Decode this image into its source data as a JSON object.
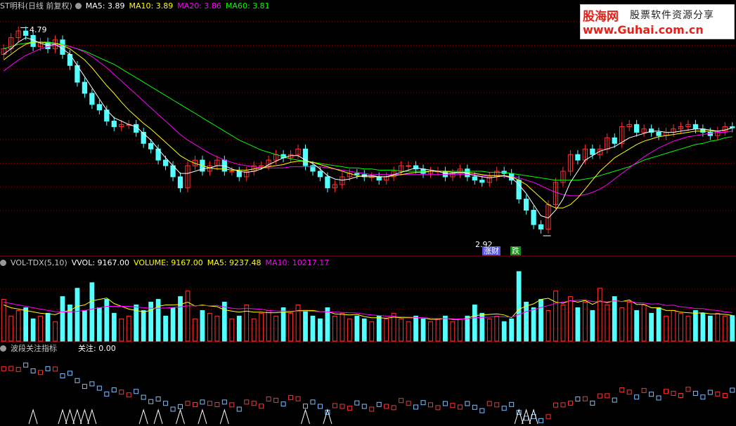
{
  "price_header": {
    "title": "ST明科(日线 前复权)",
    "ma5": "MA5: 3.89",
    "ma10": "MA10: 3.89",
    "ma20": "MA20: 3.86",
    "ma60": "MA60: 3.81"
  },
  "volume_header": {
    "title": "VOL-TDX(5,10)",
    "vvol": "VVOL: 9167.00",
    "volume": "VOLUME: 9167.00",
    "ma5": "MA5: 9237.48",
    "ma10": "MA10: 10217.17"
  },
  "indicator_header": {
    "title": "波段关注指标",
    "value": "关注: 0.00"
  },
  "logo": {
    "name": "股海网",
    "slogan": "股票软件资源分享",
    "url": "www.Guhai.com.cn"
  },
  "annotations": {
    "high_label": "4.79",
    "low_label": "2.92",
    "tag1": "涨财",
    "tag2": "跌"
  },
  "colors": {
    "up": "#ff3232",
    "down": "#54ffff",
    "ma5": "#ffffff",
    "ma10": "#ffff00",
    "ma20": "#ff00ff",
    "ma60": "#00ff00",
    "grid": "#8b0000"
  },
  "chart_data": {
    "type": "candlestick",
    "title": "ST明科(日线 前复权)",
    "ylim": [
      2.8,
      4.95
    ],
    "price_high": 4.79,
    "price_low": 2.92,
    "close": [
      4.6,
      4.7,
      4.76,
      4.72,
      4.62,
      4.66,
      4.6,
      4.68,
      4.55,
      4.45,
      4.3,
      4.2,
      4.1,
      4.05,
      3.95,
      3.9,
      3.92,
      3.92,
      3.85,
      3.75,
      3.7,
      3.6,
      3.55,
      3.45,
      3.35,
      3.55,
      3.6,
      3.5,
      3.55,
      3.6,
      3.5,
      3.5,
      3.45,
      3.5,
      3.55,
      3.55,
      3.6,
      3.65,
      3.62,
      3.65,
      3.7,
      3.55,
      3.5,
      3.45,
      3.35,
      3.38,
      3.45,
      3.48,
      3.47,
      3.45,
      3.45,
      3.42,
      3.45,
      3.5,
      3.55,
      3.55,
      3.52,
      3.48,
      3.5,
      3.5,
      3.45,
      3.48,
      3.52,
      3.45,
      3.42,
      3.4,
      3.45,
      3.5,
      3.48,
      3.42,
      3.25,
      3.15,
      3.02,
      2.98,
      3.2,
      3.4,
      3.5,
      3.65,
      3.6,
      3.7,
      3.65,
      3.7,
      3.8,
      3.75,
      3.9,
      3.92,
      3.85,
      3.88,
      3.85,
      3.82,
      3.85,
      3.88,
      3.9,
      3.92,
      3.88,
      3.85,
      3.82,
      3.86,
      3.9,
      3.89
    ],
    "ma5": [
      4.55,
      4.6,
      4.66,
      4.7,
      4.68,
      4.65,
      4.63,
      4.64,
      4.6,
      4.55,
      4.45,
      4.35,
      4.25,
      4.15,
      4.05,
      3.98,
      3.95,
      3.92,
      3.9,
      3.84,
      3.78,
      3.7,
      3.62,
      3.55,
      3.48,
      3.48,
      3.5,
      3.52,
      3.53,
      3.55,
      3.55,
      3.52,
      3.5,
      3.49,
      3.5,
      3.52,
      3.56,
      3.59,
      3.62,
      3.64,
      3.64,
      3.6,
      3.57,
      3.52,
      3.46,
      3.43,
      3.42,
      3.43,
      3.45,
      3.46,
      3.46,
      3.45,
      3.45,
      3.47,
      3.49,
      3.51,
      3.53,
      3.52,
      3.51,
      3.5,
      3.48,
      3.48,
      3.49,
      3.48,
      3.46,
      3.45,
      3.44,
      3.45,
      3.46,
      3.44,
      3.38,
      3.3,
      3.2,
      3.1,
      3.08,
      3.15,
      3.25,
      3.4,
      3.5,
      3.6,
      3.64,
      3.68,
      3.7,
      3.72,
      3.76,
      3.8,
      3.82,
      3.84,
      3.86,
      3.86,
      3.85,
      3.85,
      3.86,
      3.87,
      3.88,
      3.88,
      3.87,
      3.86,
      3.87,
      3.89
    ],
    "ma10": [
      4.5,
      4.55,
      4.6,
      4.64,
      4.66,
      4.66,
      4.65,
      4.65,
      4.63,
      4.6,
      4.55,
      4.5,
      4.43,
      4.35,
      4.27,
      4.2,
      4.12,
      4.05,
      3.99,
      3.93,
      3.88,
      3.82,
      3.76,
      3.7,
      3.64,
      3.6,
      3.57,
      3.55,
      3.53,
      3.52,
      3.52,
      3.51,
      3.51,
      3.51,
      3.52,
      3.53,
      3.54,
      3.55,
      3.56,
      3.58,
      3.59,
      3.59,
      3.58,
      3.56,
      3.54,
      3.52,
      3.5,
      3.48,
      3.46,
      3.45,
      3.45,
      3.45,
      3.45,
      3.46,
      3.47,
      3.48,
      3.49,
      3.49,
      3.5,
      3.5,
      3.5,
      3.49,
      3.49,
      3.49,
      3.48,
      3.47,
      3.46,
      3.46,
      3.46,
      3.45,
      3.42,
      3.38,
      3.32,
      3.26,
      3.2,
      3.17,
      3.17,
      3.2,
      3.26,
      3.34,
      3.42,
      3.5,
      3.56,
      3.62,
      3.66,
      3.7,
      3.74,
      3.77,
      3.79,
      3.81,
      3.82,
      3.83,
      3.84,
      3.85,
      3.86,
      3.86,
      3.86,
      3.86,
      3.87,
      3.89
    ],
    "ma20": [
      4.4,
      4.45,
      4.5,
      4.54,
      4.57,
      4.6,
      4.62,
      4.63,
      4.63,
      4.62,
      4.6,
      4.57,
      4.53,
      4.48,
      4.43,
      4.37,
      4.31,
      4.25,
      4.19,
      4.13,
      4.07,
      4.01,
      3.95,
      3.89,
      3.83,
      3.78,
      3.74,
      3.7,
      3.66,
      3.63,
      3.6,
      3.58,
      3.56,
      3.55,
      3.54,
      3.53,
      3.53,
      3.53,
      3.53,
      3.54,
      3.54,
      3.54,
      3.54,
      3.54,
      3.53,
      3.52,
      3.51,
      3.5,
      3.49,
      3.48,
      3.47,
      3.47,
      3.47,
      3.47,
      3.47,
      3.47,
      3.47,
      3.47,
      3.47,
      3.47,
      3.47,
      3.47,
      3.47,
      3.47,
      3.47,
      3.46,
      3.46,
      3.46,
      3.45,
      3.45,
      3.44,
      3.42,
      3.4,
      3.37,
      3.34,
      3.31,
      3.29,
      3.28,
      3.28,
      3.29,
      3.31,
      3.34,
      3.38,
      3.43,
      3.48,
      3.53,
      3.58,
      3.63,
      3.67,
      3.71,
      3.74,
      3.77,
      3.79,
      3.81,
      3.82,
      3.83,
      3.84,
      3.85,
      3.85,
      3.86
    ],
    "ma60": [
      4.6,
      4.62,
      4.64,
      4.65,
      4.66,
      4.66,
      4.66,
      4.65,
      4.64,
      4.62,
      4.6,
      4.58,
      4.55,
      4.52,
      4.49,
      4.46,
      4.42,
      4.38,
      4.34,
      4.3,
      4.26,
      4.22,
      4.18,
      4.14,
      4.1,
      4.06,
      4.02,
      3.98,
      3.94,
      3.9,
      3.86,
      3.82,
      3.78,
      3.75,
      3.72,
      3.69,
      3.67,
      3.65,
      3.63,
      3.61,
      3.6,
      3.59,
      3.58,
      3.57,
      3.56,
      3.55,
      3.54,
      3.53,
      3.53,
      3.52,
      3.52,
      3.51,
      3.51,
      3.51,
      3.5,
      3.5,
      3.5,
      3.5,
      3.5,
      3.5,
      3.5,
      3.5,
      3.5,
      3.5,
      3.5,
      3.5,
      3.49,
      3.49,
      3.49,
      3.48,
      3.47,
      3.46,
      3.45,
      3.44,
      3.43,
      3.42,
      3.42,
      3.42,
      3.42,
      3.43,
      3.44,
      3.46,
      3.48,
      3.5,
      3.52,
      3.54,
      3.57,
      3.6,
      3.62,
      3.64,
      3.66,
      3.68,
      3.7,
      3.72,
      3.74,
      3.75,
      3.77,
      3.78,
      3.8,
      3.81
    ],
    "volume": [
      15000,
      9000,
      11000,
      12000,
      8000,
      9000,
      10000,
      7000,
      16000,
      13000,
      19000,
      11000,
      21000,
      12000,
      15000,
      10000,
      8000,
      9000,
      13000,
      11000,
      14000,
      15000,
      9000,
      12000,
      16000,
      18000,
      8000,
      11000,
      10000,
      9000,
      14000,
      8000,
      9000,
      13000,
      8000,
      10000,
      11000,
      9000,
      12000,
      10000,
      13000,
      11000,
      9000,
      8000,
      12000,
      9000,
      10000,
      8000,
      9000,
      8000,
      7000,
      9000,
      8000,
      10000,
      8000,
      7000,
      9000,
      8000,
      7000,
      8000,
      9000,
      7000,
      8000,
      9000,
      13000,
      10000,
      8000,
      9000,
      7000,
      8000,
      25000,
      14000,
      12000,
      15000,
      11000,
      18000,
      13000,
      16000,
      12000,
      14000,
      11000,
      19000,
      13000,
      16000,
      12000,
      14000,
      11000,
      13000,
      10000,
      12000,
      9000,
      11000,
      10000,
      9000,
      11000,
      10000,
      9000,
      10000,
      9000,
      9167
    ],
    "volume_ma5": [
      13000,
      12000,
      11500,
      11000,
      10500,
      10000,
      9800,
      9500,
      10500,
      11000,
      12500,
      13000,
      14500,
      15000,
      15500,
      13500,
      12500,
      11500,
      11000,
      10500,
      11000,
      12500,
      13000,
      13000,
      13200,
      14000,
      12600,
      13000,
      12600,
      12400,
      11200,
      10800,
      10400,
      10800,
      10400,
      10400,
      10200,
      10200,
      10400,
      10400,
      11000,
      11000,
      11000,
      10600,
      10600,
      9800,
      9600,
      9400,
      9600,
      8800,
      8400,
      8400,
      8200,
      8600,
      8400,
      8400,
      8400,
      8400,
      7800,
      7800,
      8200,
      7800,
      7800,
      8200,
      9200,
      9400,
      9600,
      9800,
      9400,
      8400,
      11400,
      12600,
      13400,
      15000,
      15400,
      14000,
      13600,
      14600,
      14000,
      14600,
      13200,
      14400,
      13800,
      14600,
      14200,
      14800,
      13200,
      13200,
      12000,
      12000,
      11000,
      11000,
      10400,
      10200,
      10000,
      10200,
      9800,
      9800,
      9600,
      9237
    ],
    "volume_ma10": [
      14000,
      13500,
      13000,
      12500,
      12000,
      11500,
      11000,
      10600,
      10500,
      10500,
      10700,
      11000,
      11500,
      12000,
      12500,
      12500,
      12500,
      12500,
      12300,
      12000,
      11800,
      11800,
      11900,
      12100,
      12300,
      12700,
      12700,
      12800,
      12700,
      12800,
      12300,
      11800,
      11600,
      11800,
      11600,
      11400,
      11000,
      10800,
      10800,
      10800,
      10800,
      10800,
      10700,
      10600,
      10500,
      10400,
      10300,
      10200,
      10100,
      9700,
      9400,
      9200,
      9000,
      8900,
      8700,
      8600,
      8500,
      8400,
      8200,
      8100,
      8100,
      8000,
      7900,
      8000,
      8400,
      8500,
      8600,
      8800,
      8700,
      8600,
      9600,
      10600,
      11300,
      12100,
      12800,
      13600,
      14000,
      14500,
      14700,
      14800,
      14200,
      14200,
      14100,
      14500,
      14200,
      14300,
      13800,
      13700,
      13300,
      13400,
      12800,
      12900,
      12300,
      12100,
      11700,
      11700,
      11200,
      11000,
      10500,
      10217
    ],
    "indicator_value": 0.0
  }
}
